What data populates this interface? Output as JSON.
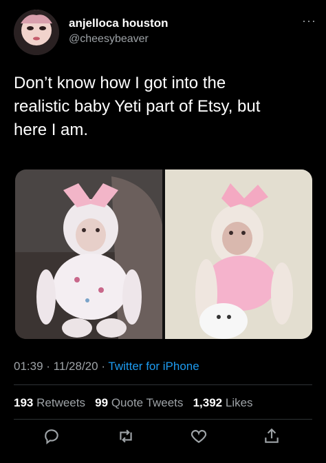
{
  "user": {
    "display_name": "anjelloca houston",
    "handle": "@cheesybeaver"
  },
  "more_icon": "more-icon",
  "tweet": {
    "text_line1": "Don’t know how I got into the",
    "text_line2": "realistic baby Yeti part of Etsy, but",
    "text_line3": "here I am."
  },
  "meta": {
    "time": "01:39",
    "date": "11/28/20",
    "source": "Twitter for iPhone"
  },
  "stats": {
    "retweets_count": "193",
    "retweets_label": "Retweets",
    "quote_tweets_count": "99",
    "quote_tweets_label": "Quote Tweets",
    "likes_count": "1,392",
    "likes_label": "Likes"
  },
  "actions": {
    "reply_icon": "reply-icon",
    "retweet_icon": "retweet-icon",
    "like_icon": "heart-icon",
    "share_icon": "share-icon"
  },
  "colors": {
    "background": "#000000",
    "text": "#ffffff",
    "secondary": "#9ea3a7",
    "link": "#1d9bf0",
    "divider": "#2f3336"
  }
}
